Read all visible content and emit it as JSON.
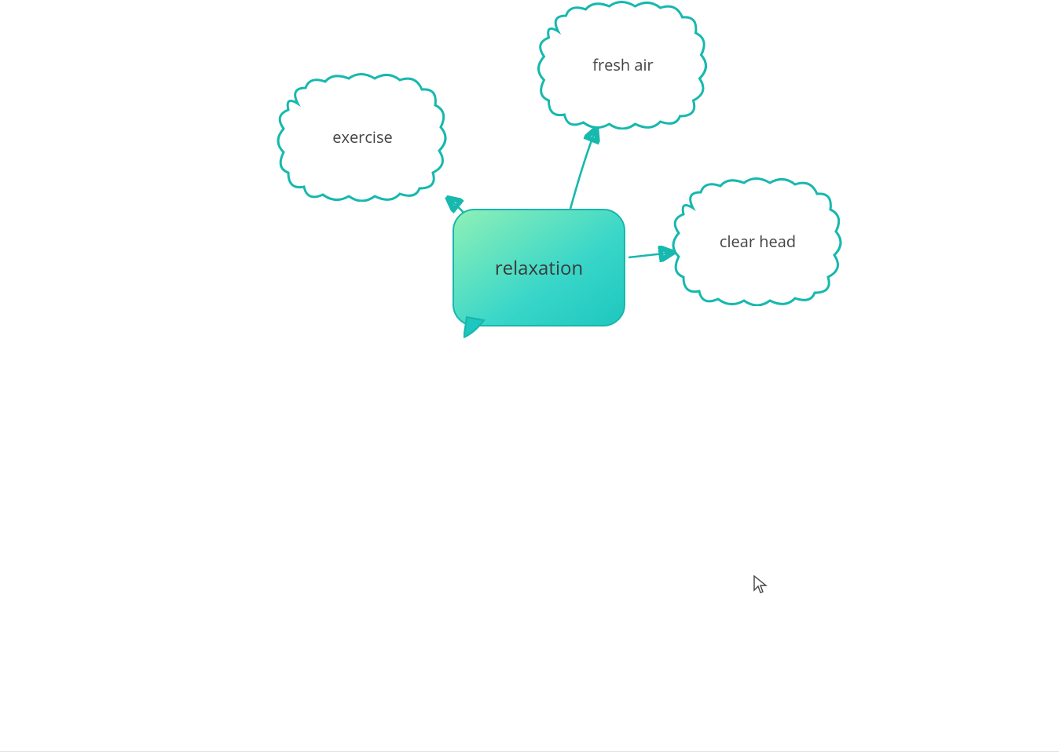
{
  "diagram": {
    "central": {
      "label": "relaxation"
    },
    "clouds": {
      "exercise": {
        "label": "exercise"
      },
      "freshair": {
        "label": "fresh air"
      },
      "clearhead": {
        "label": "clear head"
      }
    },
    "stroke_color": "#17b8ae"
  }
}
